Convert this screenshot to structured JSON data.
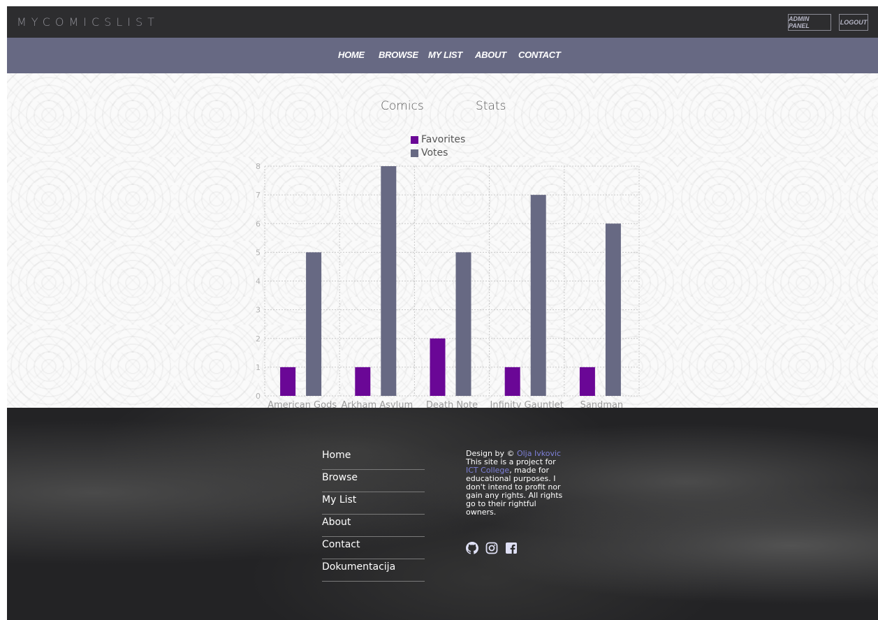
{
  "header": {
    "brand": "MYCOMICSLIST",
    "admin_panel_label": "ADMIN PANEL",
    "logout_label": "LOGOUT"
  },
  "nav": {
    "items": [
      "HOME",
      "BROWSE",
      "MY LIST",
      "ABOUT",
      "CONTACT"
    ]
  },
  "chart": {
    "title_left": "Comics",
    "title_right": "Stats"
  },
  "chart_data": {
    "type": "bar",
    "categories": [
      "American Gods",
      "Arkham Asylum",
      "Death Note",
      "Infinity Gauntlet",
      "Sandman"
    ],
    "series": [
      {
        "name": "Favorites",
        "values": [
          1,
          1,
          2,
          1,
          1
        ],
        "color": "#6a0796"
      },
      {
        "name": "Votes",
        "values": [
          5,
          8,
          5,
          7,
          6
        ],
        "color": "#676983"
      }
    ],
    "ylim": [
      0,
      8
    ],
    "yticks": [
      0,
      1,
      2,
      3,
      4,
      5,
      6,
      7,
      8
    ],
    "grid": true,
    "legend": "top-center"
  },
  "footer": {
    "links": [
      "Home",
      "Browse",
      "My List",
      "About",
      "Contact",
      "Dokumentacija"
    ],
    "design_prefix": "Design by © ",
    "designer": "Olja Ivkovic",
    "text_1": "This site is a project for ",
    "college": "ICT College",
    "text_2": ", made for educational purposes. I don't intend to profit nor gain any rights. All rights go to their rightful owners.",
    "social_icons": [
      "github-icon",
      "instagram-icon",
      "facebook-icon"
    ]
  },
  "colors": {
    "accent_purple": "#6a0796",
    "slate": "#676983",
    "link_blue": "#7e80d8"
  }
}
